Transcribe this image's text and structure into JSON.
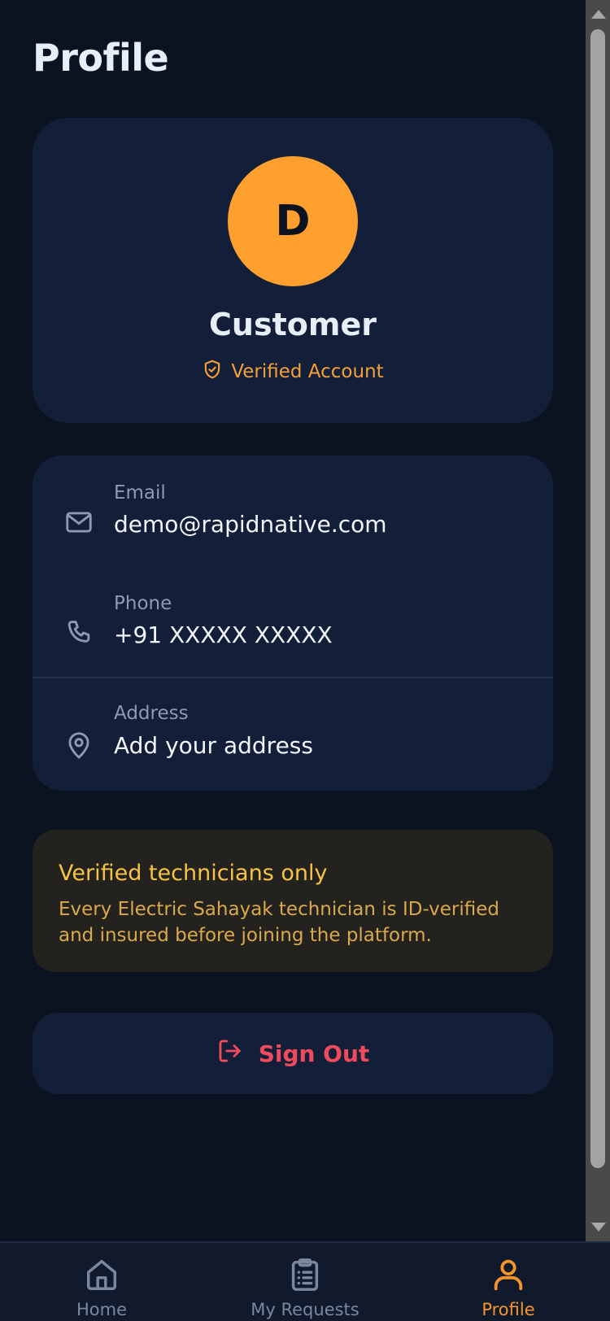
{
  "page": {
    "title": "Profile"
  },
  "profile": {
    "avatar_initial": "D",
    "name": "Customer",
    "verified_label": "Verified Account"
  },
  "contact": {
    "email": {
      "label": "Email",
      "value": "demo@rapidnative.com"
    },
    "phone": {
      "label": "Phone",
      "value": "+91 XXXXX XXXXX"
    },
    "address": {
      "label": "Address",
      "value": "Add your address"
    }
  },
  "notice": {
    "title": "Verified technicians only",
    "text": "Every Electric Sahayak technician is ID-verified and insured before joining the platform."
  },
  "signout": {
    "label": "Sign Out"
  },
  "tabbar": {
    "tabs": [
      {
        "label": "Home",
        "icon": "home-icon",
        "active": false
      },
      {
        "label": "My Requests",
        "icon": "clipboard-list-icon",
        "active": false
      },
      {
        "label": "Profile",
        "icon": "user-icon",
        "active": true
      }
    ]
  },
  "colors": {
    "background": "#0b1220",
    "card": "#131f38",
    "accent": "#ff9f2d",
    "danger": "#f04b5c",
    "notice_bg": "#24221f",
    "notice_title": "#f6c344"
  }
}
